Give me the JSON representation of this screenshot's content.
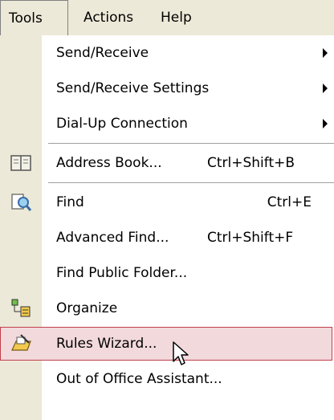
{
  "menubar": {
    "tools_label": "Tools",
    "actions_label": "Actions",
    "help_label": "Help"
  },
  "menu": {
    "items": [
      {
        "label": "Send/Receive",
        "submenu": true
      },
      {
        "label": "Send/Receive Settings",
        "submenu": true
      },
      {
        "label": "Dial-Up Connection",
        "submenu": true
      },
      {
        "label": "Address Book...",
        "shortcut": "Ctrl+Shift+B",
        "icon": "address-book-icon"
      },
      {
        "label": "Find",
        "shortcut": "Ctrl+E",
        "icon": "find-icon"
      },
      {
        "label": "Advanced Find...",
        "shortcut": "Ctrl+Shift+F"
      },
      {
        "label": "Find Public Folder..."
      },
      {
        "label": "Organize",
        "icon": "organize-icon"
      },
      {
        "label": "Rules Wizard...",
        "icon": "rules-wizard-icon",
        "highlighted": true
      },
      {
        "label": "Out of Office Assistant..."
      }
    ]
  },
  "colors": {
    "menubar_bg": "#ece9d8",
    "highlight_bg": "#f2d9dc",
    "highlight_border": "#c0404a"
  }
}
